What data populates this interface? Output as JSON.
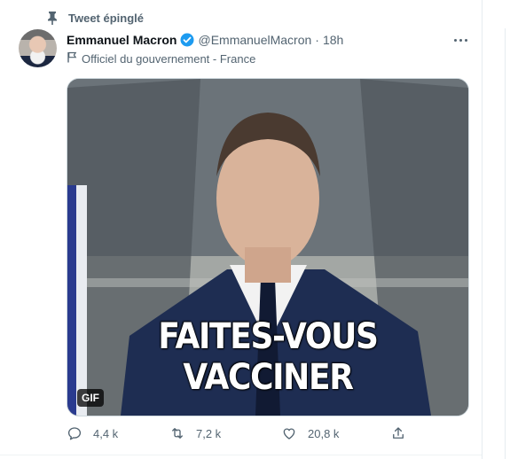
{
  "pinned": {
    "label": "Tweet épinglé",
    "icon": "pin-icon"
  },
  "author": {
    "name": "Emmanuel Macron",
    "verified_icon": "verified-badge-icon",
    "handle": "@EmmanuelMacron",
    "separator": "·",
    "time": "18h",
    "label_icon": "flag-icon",
    "label": "Officiel du gouvernement - France"
  },
  "more_icon": "more-options-icon",
  "media": {
    "caption": "FAITES-VOUS VACCINER",
    "badge": "GIF"
  },
  "actions": {
    "reply": {
      "icon": "reply-icon",
      "count": "4,4 k"
    },
    "retweet": {
      "icon": "retweet-icon",
      "count": "7,2 k"
    },
    "like": {
      "icon": "heart-icon",
      "count": "20,8 k"
    },
    "share": {
      "icon": "share-icon"
    }
  },
  "colors": {
    "text_primary": "#0f1419",
    "text_secondary": "#536471",
    "verified_blue": "#1d9bf0",
    "border": "#cfd9de"
  }
}
